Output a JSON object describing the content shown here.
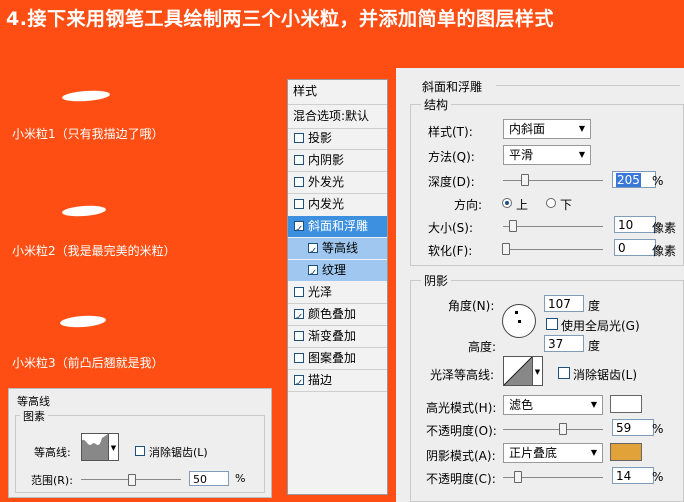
{
  "headline": "4.接下来用钢笔工具绘制两三个小米粒，并添加简单的图层样式",
  "grains": [
    {
      "label": "小米粒1（只有我描边了哦）"
    },
    {
      "label": "小米粒2（我是最完美的米粒）"
    },
    {
      "label": "小米粒3（前凸后翘就是我）"
    }
  ],
  "contour_panel": {
    "title": "等高线",
    "group": "图素",
    "contour_label": "等高线:",
    "antialias_label": "消除锯齿(L)",
    "antialias_checked": false,
    "range_label": "范围(R):",
    "range_value": "50",
    "range_unit": "%"
  },
  "style_list": {
    "header": "样式",
    "blend_options": "混合选项:默认",
    "items": [
      {
        "label": "投影",
        "checked": false
      },
      {
        "label": "内阴影",
        "checked": false
      },
      {
        "label": "外发光",
        "checked": false
      },
      {
        "label": "内发光",
        "checked": false
      },
      {
        "label": "斜面和浮雕",
        "checked": true,
        "selected": true
      },
      {
        "label": "等高线",
        "checked": true,
        "sub": true
      },
      {
        "label": "纹理",
        "checked": true,
        "sub": true
      },
      {
        "label": "光泽",
        "checked": false
      },
      {
        "label": "颜色叠加",
        "checked": true
      },
      {
        "label": "渐变叠加",
        "checked": false
      },
      {
        "label": "图案叠加",
        "checked": false
      },
      {
        "label": "描边",
        "checked": true
      }
    ]
  },
  "bevel": {
    "title": "斜面和浮雕",
    "structure": "结构",
    "style_label": "样式(T):",
    "style_value": "内斜面",
    "technique_label": "方法(Q):",
    "technique_value": "平滑",
    "depth_label": "深度(D):",
    "depth_value": "205",
    "direction_label": "方向:",
    "direction_up": "上",
    "direction_down": "下",
    "direction_selected": "上",
    "size_label": "大小(S):",
    "size_value": "10",
    "soften_label": "软化(F):",
    "soften_value": "0",
    "pct": "%",
    "px": "像素",
    "shading": "阴影",
    "angle_label": "角度(N):",
    "angle_value": "107",
    "degree": "度",
    "global_light_label": "使用全局光(G)",
    "global_light_checked": false,
    "altitude_label": "高度:",
    "altitude_value": "37",
    "gloss_label": "光泽等高线:",
    "gloss_antialias_label": "消除锯齿(L)",
    "highlight_mode_label": "高光模式(H):",
    "highlight_mode_value": "滤色",
    "highlight_color": "#ffffff",
    "highlight_opacity_label": "不透明度(O):",
    "highlight_opacity_value": "59",
    "shadow_mode_label": "阴影模式(A):",
    "shadow_mode_value": "正片叠底",
    "shadow_color": "#e2a23a",
    "shadow_opacity_label": "不透明度(C):",
    "shadow_opacity_value": "14"
  }
}
